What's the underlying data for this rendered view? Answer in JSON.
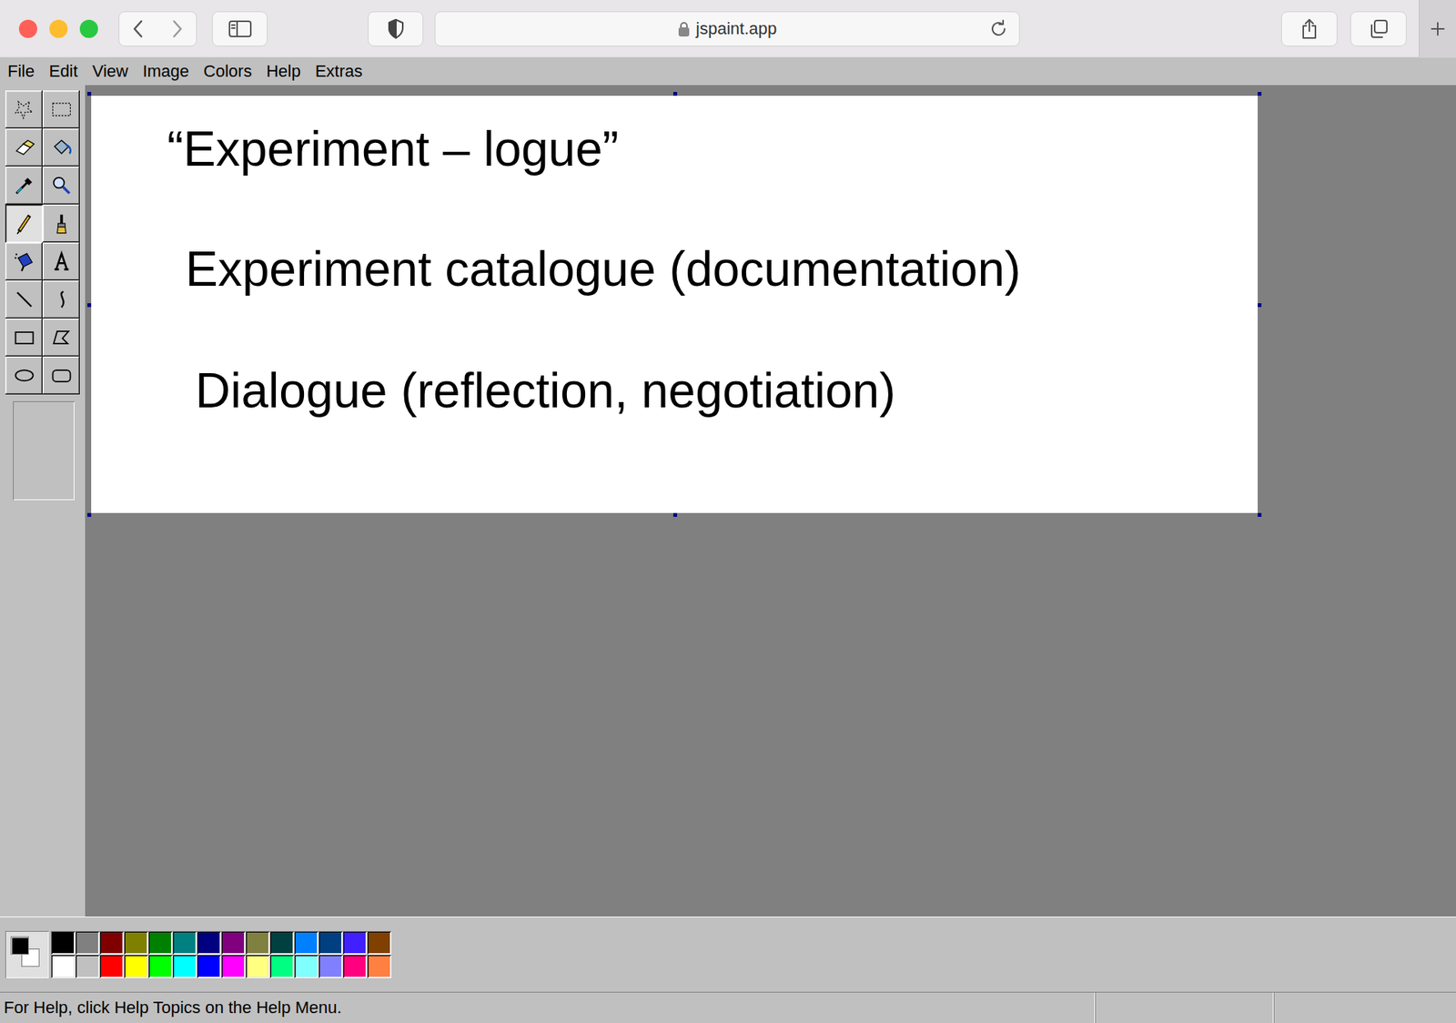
{
  "browser": {
    "url": "jspaint.app"
  },
  "menu": [
    "File",
    "Edit",
    "View",
    "Image",
    "Colors",
    "Help",
    "Extras"
  ],
  "tools": [
    {
      "kind": "free-form-select",
      "selected": false
    },
    {
      "kind": "select",
      "selected": false
    },
    {
      "kind": "eraser",
      "selected": false
    },
    {
      "kind": "fill",
      "selected": false
    },
    {
      "kind": "pick-color",
      "selected": false
    },
    {
      "kind": "magnifier",
      "selected": false
    },
    {
      "kind": "pencil",
      "selected": true
    },
    {
      "kind": "brush",
      "selected": false
    },
    {
      "kind": "airbrush",
      "selected": false
    },
    {
      "kind": "text",
      "selected": false
    },
    {
      "kind": "line",
      "selected": false
    },
    {
      "kind": "curve",
      "selected": false
    },
    {
      "kind": "rectangle",
      "selected": false
    },
    {
      "kind": "polygon",
      "selected": false
    },
    {
      "kind": "ellipse",
      "selected": false
    },
    {
      "kind": "rounded-rectangle",
      "selected": false
    }
  ],
  "current_colors": {
    "foreground": "#000000",
    "background": "#ffffff"
  },
  "palette": [
    {
      "color": "#000000"
    },
    {
      "color": "#808080"
    },
    {
      "color": "#800000"
    },
    {
      "color": "#808000"
    },
    {
      "color": "#008000"
    },
    {
      "color": "#008080"
    },
    {
      "color": "#000080"
    },
    {
      "color": "#800080"
    },
    {
      "color": "#808040"
    },
    {
      "color": "#004040"
    },
    {
      "color": "#0080ff"
    },
    {
      "color": "#004080"
    },
    {
      "color": "#4020ff"
    },
    {
      "color": "#804000"
    },
    {
      "color": "#ffffff"
    },
    {
      "color": "#c0c0c0"
    },
    {
      "color": "#ff0000"
    },
    {
      "color": "#ffff00"
    },
    {
      "color": "#00ff00"
    },
    {
      "color": "#00ffff"
    },
    {
      "color": "#0000ff"
    },
    {
      "color": "#ff00ff"
    },
    {
      "color": "#ffff80"
    },
    {
      "color": "#00ff80"
    },
    {
      "color": "#80ffff"
    },
    {
      "color": "#8080ff"
    },
    {
      "color": "#ff0080"
    },
    {
      "color": "#ff8040"
    }
  ],
  "canvas": {
    "lines": [
      "“Experiment – logue”",
      "Experiment catalogue (documentation)",
      "Dialogue (reflection, negotiation)"
    ]
  },
  "status_bar": {
    "text": "For Help, click Help Topics on the Help Menu."
  }
}
